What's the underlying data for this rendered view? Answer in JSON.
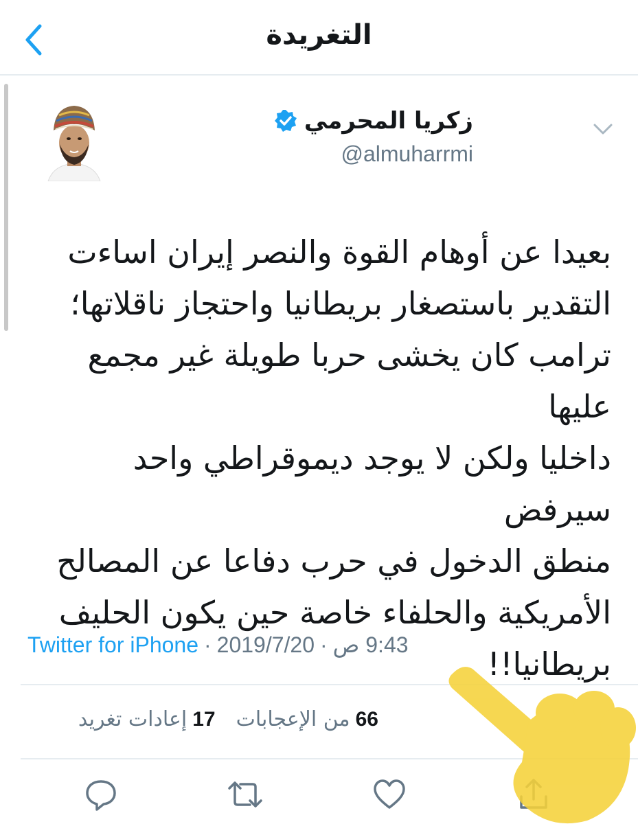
{
  "header": {
    "title": "التغريدة",
    "back_icon": "chevron-left-icon"
  },
  "tweet": {
    "author": {
      "display_name": "زكريا المحرمي",
      "handle": "@almuharrmi",
      "verified": true
    },
    "text_lines": [
      "بعيدا عن أوهام القوة والنصر إيران اساءت",
      "التقدير باستصغار بريطانيا واحتجاز ناقلاتها؛",
      "ترامب كان يخشى حربا طويلة غير مجمع عليها",
      "داخليا ولكن لا يوجد ديموقراطي واحد سيرفض",
      "منطق الدخول في حرب دفاعا عن المصالح",
      "الأمريكية والحلفاء خاصة حين يكون الحليف",
      "بريطانيا!!"
    ],
    "time": "9:43 ص",
    "date": "2019/7/20",
    "source": "Twitter for iPhone",
    "separator": "·",
    "stats": {
      "retweets_count": "17",
      "retweets_label": "إعادات تغريد",
      "likes_count": "66",
      "likes_label": "من الإعجابات"
    }
  },
  "actions": [
    "reply-icon",
    "retweet-icon",
    "like-icon",
    "share-icon"
  ],
  "colors": {
    "accent": "#1da1f2",
    "secondary_text": "#657786",
    "divider": "#e6ecf0",
    "highlight_overlay": "#f5d23a"
  }
}
